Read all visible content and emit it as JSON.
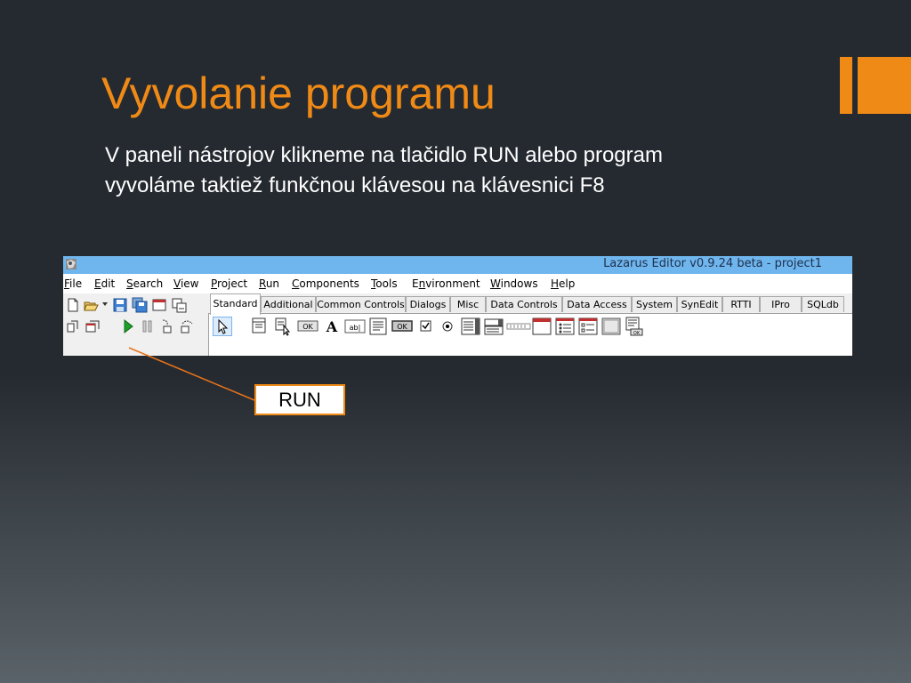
{
  "slide": {
    "title": "Vyvolanie programu",
    "body_lines": [
      "V paneli nástrojov klikneme na tlačidlo RUN alebo program",
      "vyvoláme taktiež funkčnou klávesou na klávesnici F8"
    ],
    "callout_label": "RUN",
    "colors": {
      "accent": "#f08a16",
      "background": "#252a30",
      "text": "#ffffff"
    }
  },
  "ide": {
    "window_title": "Lazarus Editor v0.9.24 beta - project1",
    "menu": [
      {
        "mn": "F",
        "rest": "ile"
      },
      {
        "mn": "E",
        "rest": "dit"
      },
      {
        "mn": "S",
        "rest": "earch"
      },
      {
        "mn": "V",
        "rest": "iew"
      },
      {
        "mn": "P",
        "rest": "roject"
      },
      {
        "mn": "R",
        "rest": "un"
      },
      {
        "mn": "C",
        "rest": "omponents"
      },
      {
        "mn": "T",
        "rest": "ools"
      },
      {
        "pre": "E",
        "mn": "n",
        "rest": "vironment"
      },
      {
        "mn": "W",
        "rest": "indows"
      },
      {
        "mn": "H",
        "rest": "elp"
      }
    ],
    "tabs": [
      "Standard",
      "Additional",
      "Common Controls",
      "Dialogs",
      "Misc",
      "Data Controls",
      "Data Access",
      "System",
      "SynEdit",
      "RTTI",
      "IPro",
      "SQLdb"
    ],
    "active_tab": "Standard",
    "palette_labels": {
      "button": "OK",
      "label": "A",
      "edit": "ab|",
      "bitbtn": "OK",
      "okbox": "OK"
    },
    "toolbar_icons": [
      "new-file-icon",
      "open-file-icon",
      "save-icon",
      "save-all-icon",
      "new-form-icon",
      "toggle-form-icon",
      "view-units-icon",
      "view-forms-icon",
      "run-icon",
      "pause-icon",
      "step-into-icon",
      "step-over-icon"
    ],
    "colors": {
      "titlebar": "#6fb6ee",
      "run_icon": "#1e9e2a"
    }
  }
}
